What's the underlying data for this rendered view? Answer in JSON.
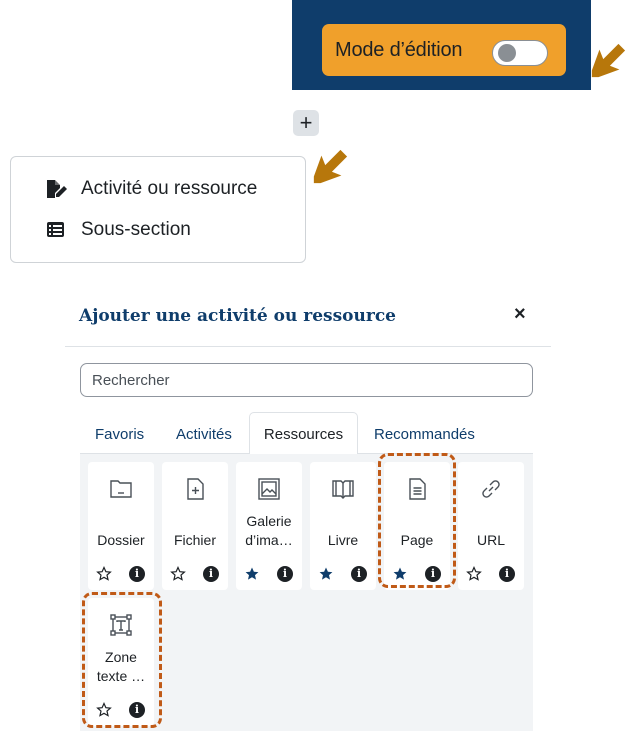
{
  "edit_mode": {
    "label": "Mode d’édition",
    "enabled": false
  },
  "add_button": {
    "symbol": "+"
  },
  "add_menu": {
    "items": [
      {
        "label": "Activité ou ressource",
        "icon": "file-pen-icon"
      },
      {
        "label": "Sous-section",
        "icon": "list-section-icon"
      }
    ]
  },
  "modal": {
    "title": "Ajouter une activité ou ressource",
    "close_symbol": "×",
    "search": {
      "placeholder": "Rechercher",
      "value": ""
    },
    "tabs": [
      {
        "label": "Favoris",
        "active": false
      },
      {
        "label": "Activités",
        "active": false
      },
      {
        "label": "Ressources",
        "active": true
      },
      {
        "label": "Recommandés",
        "active": false
      }
    ],
    "resources": [
      {
        "name": "Dossier",
        "lines": [
          "Dossier"
        ],
        "icon": "folder-icon",
        "starred": false
      },
      {
        "name": "Fichier",
        "lines": [
          "Fichier"
        ],
        "icon": "file-plus-icon",
        "starred": false
      },
      {
        "name": "Galerie d'images",
        "lines": [
          "Galerie",
          "d’ima…"
        ],
        "icon": "image-gallery-icon",
        "starred": true
      },
      {
        "name": "Livre",
        "lines": [
          "Livre"
        ],
        "icon": "book-icon",
        "starred": true
      },
      {
        "name": "Page",
        "lines": [
          "Page"
        ],
        "icon": "page-icon",
        "starred": true
      },
      {
        "name": "URL",
        "lines": [
          "URL"
        ],
        "icon": "link-icon",
        "starred": false
      },
      {
        "name": "Zone texte",
        "lines": [
          "Zone",
          "texte …"
        ],
        "icon": "text-area-icon",
        "starred": false
      }
    ],
    "info_glyph": "i"
  },
  "colors": {
    "header_bg": "#0f3d6b",
    "edit_pill": "#f0a02b",
    "arrow": "#b7770b",
    "highlight": "#c05a17",
    "title": "#0f3d6b",
    "star_filled": "#0f3d6b"
  }
}
